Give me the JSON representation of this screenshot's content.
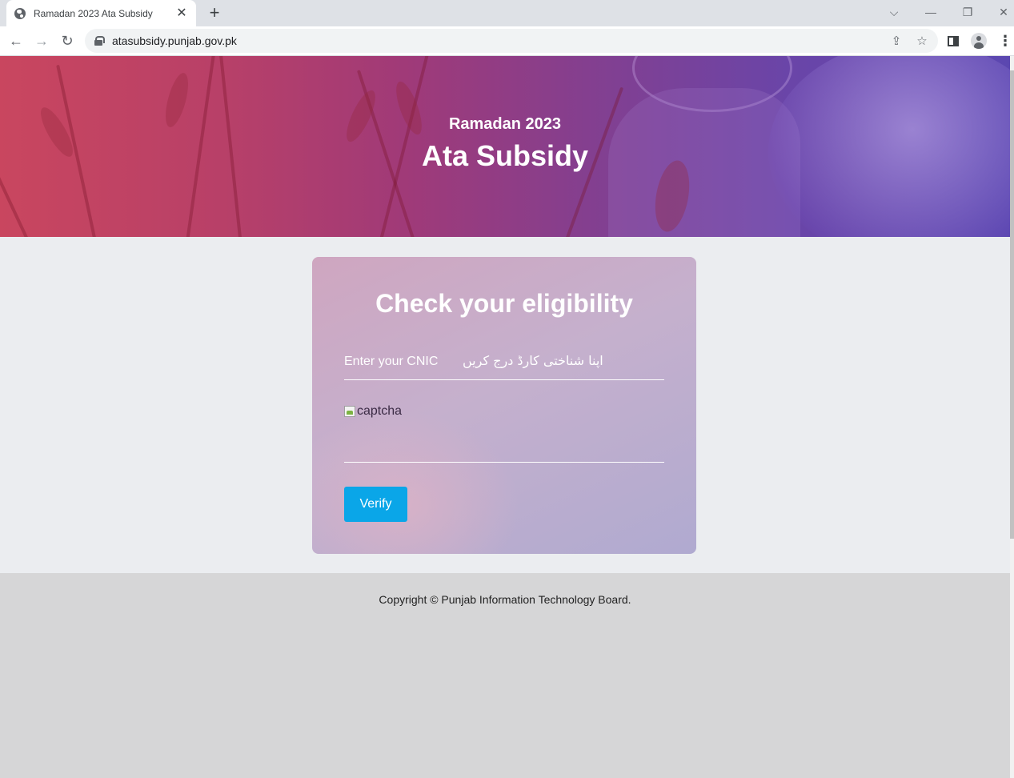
{
  "browser": {
    "tab_title": "Ramadan 2023 Ata Subsidy",
    "tab_close": "✕",
    "new_tab": "+",
    "url": "atasubsidy.punjab.gov.pk",
    "controls": {
      "tab_search": "⌵",
      "minimize": "—",
      "restore": "❐",
      "close": "✕"
    },
    "nav": {
      "back": "←",
      "forward": "→",
      "reload": "↻"
    },
    "omnibox_icons": {
      "share": "⇪",
      "bookmark": "☆"
    },
    "menu": "⋮"
  },
  "banner": {
    "subtitle": "Ramadan 2023",
    "title": "Ata Subsidy"
  },
  "form": {
    "title": "Check your eligibility",
    "cnic_label": "Enter your CNIC",
    "cnic_label_urdu": "اپنا شناختی کارڈ درج کریں",
    "cnic_value": "",
    "captcha_alt": "captcha",
    "verify_label": "Verify"
  },
  "footer": {
    "copyright": "Copyright © Punjab Information Technology Board."
  },
  "colors": {
    "verify_button": "#0aa6e8",
    "page_background": "#ebedf0",
    "footer_background": "#d6d6d7"
  }
}
